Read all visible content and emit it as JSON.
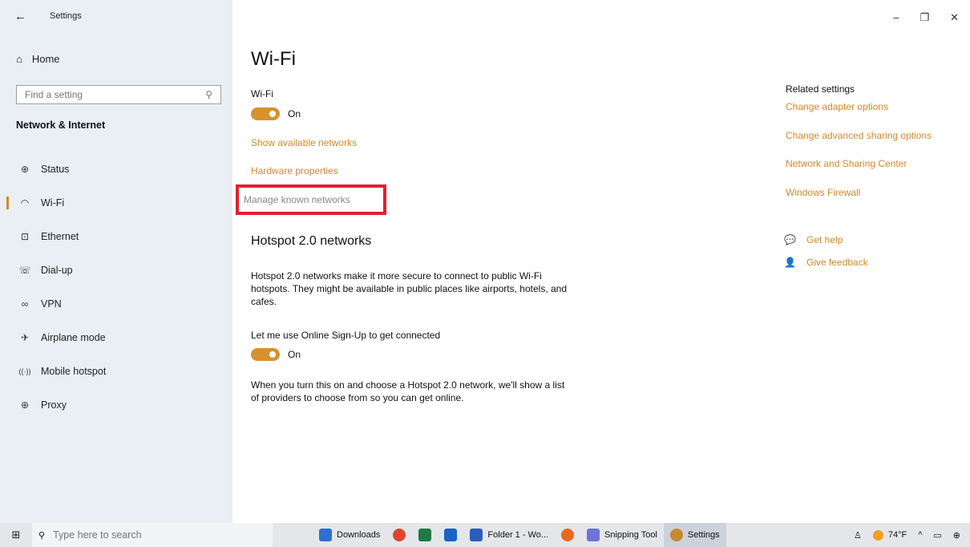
{
  "window": {
    "title": "Settings",
    "controls": {
      "minimize": "–",
      "maximize": "❐",
      "close": "✕"
    }
  },
  "sidebar": {
    "home_label": "Home",
    "search_placeholder": "Find a setting",
    "section_title": "Network & Internet",
    "items": [
      {
        "label": "Status",
        "icon": "status-icon",
        "glyph": "⊕"
      },
      {
        "label": "Wi-Fi",
        "icon": "wifi-icon",
        "glyph": "◠",
        "active": true
      },
      {
        "label": "Ethernet",
        "icon": "ethernet-icon",
        "glyph": "⊡"
      },
      {
        "label": "Dial-up",
        "icon": "dialup-icon",
        "glyph": "☏"
      },
      {
        "label": "VPN",
        "icon": "vpn-icon",
        "glyph": "∞"
      },
      {
        "label": "Airplane mode",
        "icon": "airplane-icon",
        "glyph": "✈"
      },
      {
        "label": "Mobile hotspot",
        "icon": "hotspot-icon",
        "glyph": "((·))"
      },
      {
        "label": "Proxy",
        "icon": "proxy-icon",
        "glyph": "⊕"
      }
    ]
  },
  "main": {
    "page_title": "Wi-Fi",
    "wifi_label": "Wi-Fi",
    "wifi_toggle": "On",
    "show_networks": "Show available networks",
    "hardware_properties": "Hardware properties",
    "manage_known": "Manage known networks",
    "hotspot_title": "Hotspot 2.0 networks",
    "hotspot_desc": "Hotspot 2.0 networks make it more secure to connect to public Wi-Fi hotspots. They might be available in public places like airports, hotels, and cafes.",
    "online_signup_label": "Let me use Online Sign-Up to get connected",
    "online_signup_toggle": "On",
    "online_signup_desc": "When you turn this on and choose a Hotspot 2.0 network, we'll show a list of providers to choose from so you can get online."
  },
  "related": {
    "title": "Related settings",
    "links": [
      "Change adapter options",
      "Change advanced sharing options",
      "Network and Sharing Center",
      "Windows Firewall"
    ],
    "get_help": "Get help",
    "give_feedback": "Give feedback"
  },
  "taskbar": {
    "search_placeholder": "Type here to search",
    "items": [
      {
        "label": "Downloads",
        "icon": "downloads-icon",
        "color": "#2f6fd1"
      },
      {
        "label": "",
        "icon": "chrome-icon",
        "color": "#e0452f"
      },
      {
        "label": "",
        "icon": "excel-icon",
        "color": "#1d7a45"
      },
      {
        "label": "",
        "icon": "outlook-icon",
        "color": "#1a63c4"
      },
      {
        "label": "Folder 1 - Wo...",
        "icon": "word-icon",
        "color": "#2b5cb8"
      },
      {
        "label": "",
        "icon": "firefox-icon",
        "color": "#e86a1f"
      },
      {
        "label": "Snipping Tool",
        "icon": "snipping-icon",
        "color": "#6d74d6"
      },
      {
        "label": "Settings",
        "icon": "settings-icon",
        "color": "#c9882c",
        "active": true
      }
    ],
    "weather": "74°F",
    "accent_color": "#cf8a2a"
  }
}
